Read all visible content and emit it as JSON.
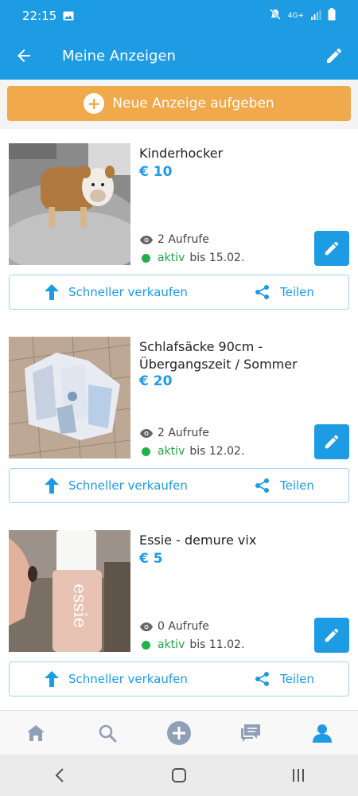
{
  "status_bar": {
    "time": "22:15",
    "network": "4G+"
  },
  "app_bar": {
    "title": "Meine Anzeigen"
  },
  "new_listing_button": {
    "label": "Neue Anzeige aufgeben"
  },
  "listings": [
    {
      "title": "Kinderhocker",
      "price": "€ 10",
      "views": "2 Aufrufe",
      "status": "aktiv",
      "until": "bis 15.02.",
      "boost_label": "Schneller verkaufen",
      "share_label": "Teilen"
    },
    {
      "title": "Schlafsäcke 90cm - Übergangszeit / Sommer",
      "price": "€ 20",
      "views": "2 Aufrufe",
      "status": "aktiv",
      "until": "bis 12.02.",
      "boost_label": "Schneller verkaufen",
      "share_label": "Teilen"
    },
    {
      "title": "Essie - demure vix",
      "price": "€ 5",
      "views": "0 Aufrufe",
      "status": "aktiv",
      "until": "bis 11.02.",
      "boost_label": "Schneller verkaufen",
      "share_label": "Teilen"
    }
  ],
  "bottom_nav": [
    "home-icon",
    "search-icon",
    "add-icon",
    "messages-icon",
    "profile-icon"
  ],
  "colors": {
    "primary": "#1d9be3",
    "accent": "#f0a94b",
    "active": "#21b04b"
  }
}
